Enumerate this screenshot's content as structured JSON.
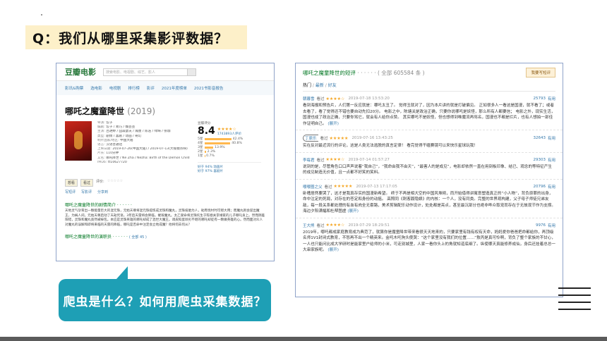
{
  "slide": {
    "title": "Q：我们从哪里采集影评数据？",
    "callout": "爬虫是什么？如何用爬虫采集数据？"
  },
  "douban": {
    "logo": "豆瓣电影",
    "search_placeholder": "搜索电影、电视剧、综艺、影人",
    "nav": [
      "影讯&购票",
      "选电影",
      "电视剧",
      "排行榜",
      "影评",
      "2021年度榜单",
      "2021书影音报告"
    ],
    "movie_title": "哪吒之魔童降世",
    "year": "(2019)",
    "info": [
      {
        "label": "导演:",
        "value": "饺子"
      },
      {
        "label": "编剧:",
        "value": "饺子 / 易巧 / 魏芸芸"
      },
      {
        "label": "主演:",
        "value": "吕艳婷 / 囧森瑟夫 / 瀚墨 / 陈浩 / 绿绮 / 张珈"
      },
      {
        "label": "类型:",
        "value": "剧情 / 喜剧 / 动画 / 奇幻"
      },
      {
        "label": "制片国家/地区:",
        "value": "中国大陆"
      },
      {
        "label": "语言:",
        "value": "汉语普通话"
      },
      {
        "label": "上映日期:",
        "value": "2019-07-26(中国大陆) / 2019-07-13(大规模点映)"
      },
      {
        "label": "片长:",
        "value": "110分钟"
      },
      {
        "label": "又名:",
        "value": "哪吒降世 / Ne Zha / Nezha: Birth of the Demon Child"
      },
      {
        "label": "IMDb:",
        "value": "tt10627720"
      }
    ],
    "rating_label": "豆瓣评分",
    "score": "8.4",
    "rating_count": "1743893人评价",
    "stars": "★★★★☆",
    "distribution": [
      {
        "label": "5星",
        "pct": 42.4
      },
      {
        "label": "4星",
        "pct": 40.8
      },
      {
        "label": "3星",
        "pct": 13.9
      },
      {
        "label": "2星",
        "pct": 2.3
      },
      {
        "label": "1星",
        "pct": 0.7
      }
    ],
    "better_than": [
      "好于 94% 动画片",
      "好于 97% 喜剧片"
    ],
    "actions": {
      "want": "想看",
      "seen": "看过",
      "rate_label": "评价:",
      "rate_stars": "☆☆☆☆☆"
    },
    "links": [
      "写短评",
      "写影评",
      "分享到"
    ],
    "synopsis_heading": "哪吒之魔童降世的剧情简介 · · · · · ·",
    "synopsis": "天地灵气孕育出一颗能量巨大的混元珠，元始天尊将混元珠提炼成灵珠和魔丸，灵珠投胎为人，助周伐纣时可堪大用；而魔丸则会诞出魔王，为祸人间。元始天尊启动了天劫咒语，3年后天雷将会降临，摧毁魔丸。太乙受命将灵珠托生于陈塘关李靖家的儿子哪吒身上。然而阴差阳错，灵珠和魔丸竟然被掉包。本应是灵珠英雄的哪吒却成了混世大魔王。调皮捣蛋顽劣不堪的哪吒却徒有一颗做英雄的心。然而面对众人对魔丸的误解和即将来临的天雷的降临，哪吒是否命中注定会立地成魔？他将何去何从？",
    "reviews_heading": "哪吒之魔童降世的演职员 · · · · · ·",
    "reviews_heading_extra": "( 全部 45 )"
  },
  "reviews": {
    "title": "哪吒之魔童降世的短评",
    "count": "· · · · · · ( 全部 605584 条 )",
    "write": "我要写短评",
    "tabs": {
      "hot": "热门",
      "sep": " / ",
      "latest": "最新",
      "friends": "好友"
    },
    "items": [
      {
        "user": "朝暮雪",
        "seen": "看过",
        "stars": "★★★★☆",
        "time": "2019-07-18 13:53:20",
        "votes": "25793",
        "useful": "有用",
        "text": "看到海报和预告片，人们第一反应就是：哪吒太丑了。 觉得丑就对了，因为本片讲的就是打破偏见。 正如很多人一看这是国漫，就不看了；或者去看了，看了觉得还不错也要自动先扣20分。 电影之中，陈塘关是政治正确，只要你说哪吒是妖怪，那么所有人都要信； 电影之外，现实生活，国漫也成了政治正确，只要你骂它，就会有人给你点赞。 其实哪吒不是妖怪，但也想得到唯魔流再骂名，国漫也不都是烂片，也有人想拍一部佳作证明自己。",
        "more": "(展开)"
      },
      {
        "user": "丁原乐",
        "seen": "看过",
        "stars": "★★★★★",
        "time": "2019-07-16 13:43:25",
        "votes": "32643",
        "useful": "有用",
        "text": "实在反对最近流行的评论，这是人类无法逃脱的真言定律！ 看完觉得干磕赛镜可以来快乐星球玩我！",
        "more": ""
      },
      {
        "user": "李每君",
        "seen": "看过",
        "stars": "★★★★☆",
        "time": "2019-07-14 01:57:27",
        "votes": "29303",
        "useful": "有用",
        "text": "说到的是，尽管角色口口声声说着“我自己”，“我命由我不由天”，“最害人的是成见”，电影却依然一直在用刻板印象、结已、观念的等特征产生的成见制造无价值，且一点都不好笑的笑料。",
        "more": ""
      },
      {
        "user": "嘤嘤圈之父",
        "seen": "看过",
        "stars": "★★★★★",
        "time": "2019-07-13 17:17:05",
        "votes": "20796",
        "useful": "有用",
        "text": "卧槽居然要哭了，这才是我真存实的国漫新希望。 终于不再是相大空的中国风堆砌，而开始借得讲寓意塑造真正的“小人物”，背负原罪的出身，命中注定的死局，对存在的苍定和身份的动摇。 高照同《刺客聂隐娘》的内核：一个人，没有同类。完整的世界观构建，父子母子师徒兄弟友敌，每一段关系都处理的有血有肉全无套路，美术剪辑配乐动作设计，处处都是亮点，甚至最沉部分也绝非哗众取宠而存在于无故现节作为支撑。海边夕阳满幅和杜帮图虚",
        "more": "(展开)"
      },
      {
        "user": "王大熊",
        "seen": "看过",
        "stars": "★★★★☆",
        "time": "2019-07-29 18:29:51",
        "votes": "9976",
        "useful": "有用",
        "text": "2019年，哪吒都成家庭教育成为典范了，就算你是魔童降世带来看很天天地来的，只要家里有钱有权有天命，妈妈爱你爸爸把命都给你，再顶级名师1V1封闭式教育，不怒再不出一个精英来。金吒木吒狗头傻哭：“这个家里没有我们的位置……”敖丙是真可怜啊，背负了整个家族的不甘心，一人也只能问比成大学研时是能家里户给师的小米，可走别城里，人家一看你头上的角就知道底细了。纵使哪天真能修养成仙，身后还挂着总总一大串家族呢。",
        "more": "(展开)"
      }
    ]
  }
}
